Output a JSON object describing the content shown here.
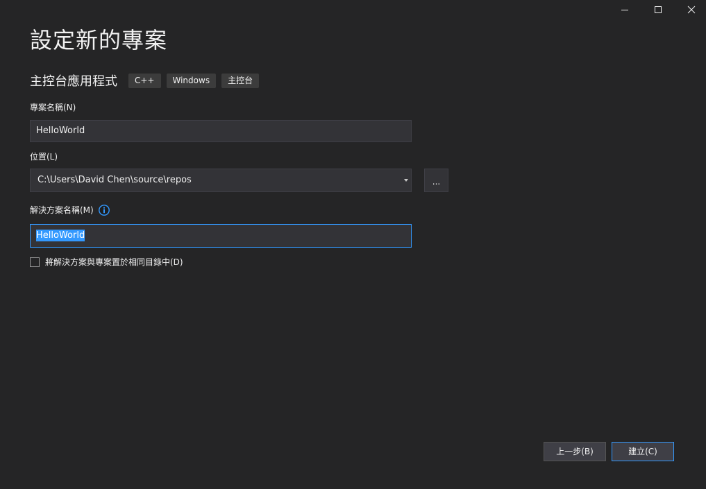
{
  "window": {
    "title": "設定新的專案",
    "controls": {
      "minimize_icon": "minimize-icon",
      "maximize_icon": "maximize-icon",
      "close_icon": "close-icon"
    }
  },
  "template": {
    "name": "主控台應用程式",
    "tags": [
      "C++",
      "Windows",
      "主控台"
    ]
  },
  "form": {
    "project_name": {
      "label": "專案名稱(N)",
      "value": "HelloWorld"
    },
    "location": {
      "label": "位置(L)",
      "value": "C:\\Users\\David Chen\\source\\repos",
      "browse_label": "..."
    },
    "solution_name": {
      "label": "解決方案名稱(M)",
      "value": "HelloWorld",
      "info_icon": "info-icon"
    },
    "same_directory": {
      "label": "將解決方案與專案置於相同目錄中(D)",
      "checked": false
    }
  },
  "footer": {
    "back_label": "上一步(B)",
    "create_label": "建立(C)"
  },
  "colors": {
    "background": "#252526",
    "input_background": "#333337",
    "accent": "#3399ff",
    "text": "#f1f1f1"
  }
}
